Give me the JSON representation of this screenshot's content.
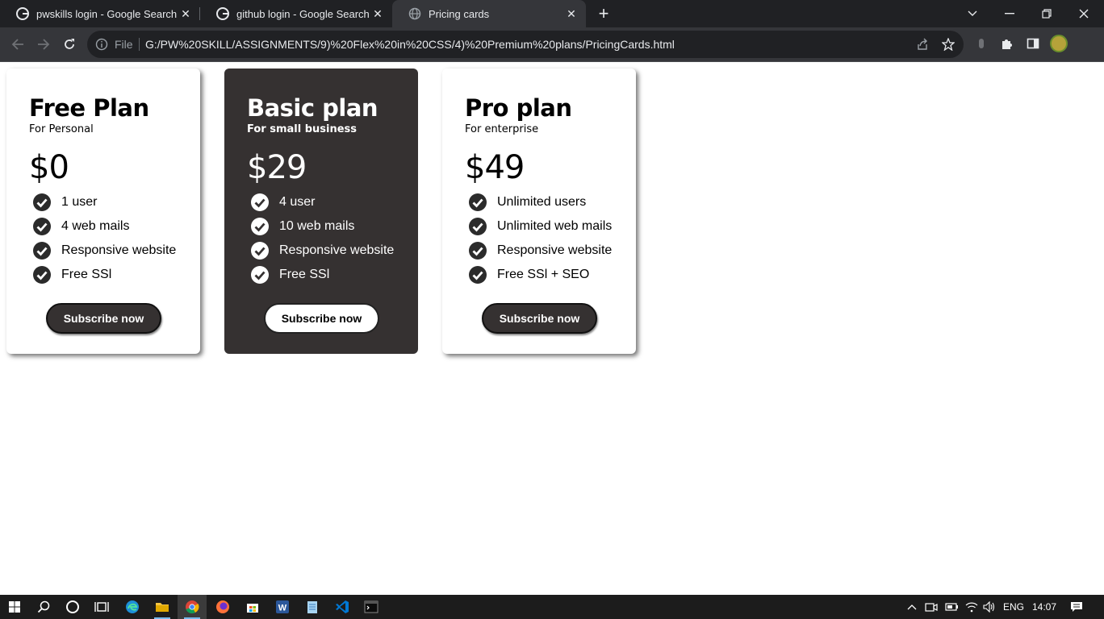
{
  "browser": {
    "tabs": [
      {
        "title": "pwskills login - Google Search"
      },
      {
        "title": "github login - Google Search"
      },
      {
        "title": "Pricing cards"
      }
    ],
    "address": {
      "scheme_label": "File",
      "url": "G:/PW%20SKILL/ASSIGNMENTS/9)%20Flex%20in%20CSS/4)%20Premium%20plans/PricingCards.html"
    }
  },
  "plans": [
    {
      "name": "Free Plan",
      "audience": "For Personal",
      "price": "$0",
      "features": [
        "1 user",
        "4 web mails",
        "Responsive website",
        "Free SSl"
      ],
      "button": "Subscribe now"
    },
    {
      "name": "Basic plan",
      "audience": "For small business",
      "price": "$29",
      "features": [
        "4 user",
        "10 web mails",
        "Responsive website",
        "Free SSl"
      ],
      "button": "Subscribe now"
    },
    {
      "name": "Pro plan",
      "audience": "For enterprise",
      "price": "$49",
      "features": [
        "Unlimited users",
        "Unlimited web mails",
        "Responsive website",
        "Free SSl + SEO"
      ],
      "button": "Subscribe now"
    }
  ],
  "taskbar": {
    "language": "ENG",
    "time": "14:07"
  },
  "colors": {
    "dark_card": "#353131",
    "check_icon": "#2b2b2b",
    "browser_frame": "#202124",
    "toolbar": "#35363a"
  }
}
